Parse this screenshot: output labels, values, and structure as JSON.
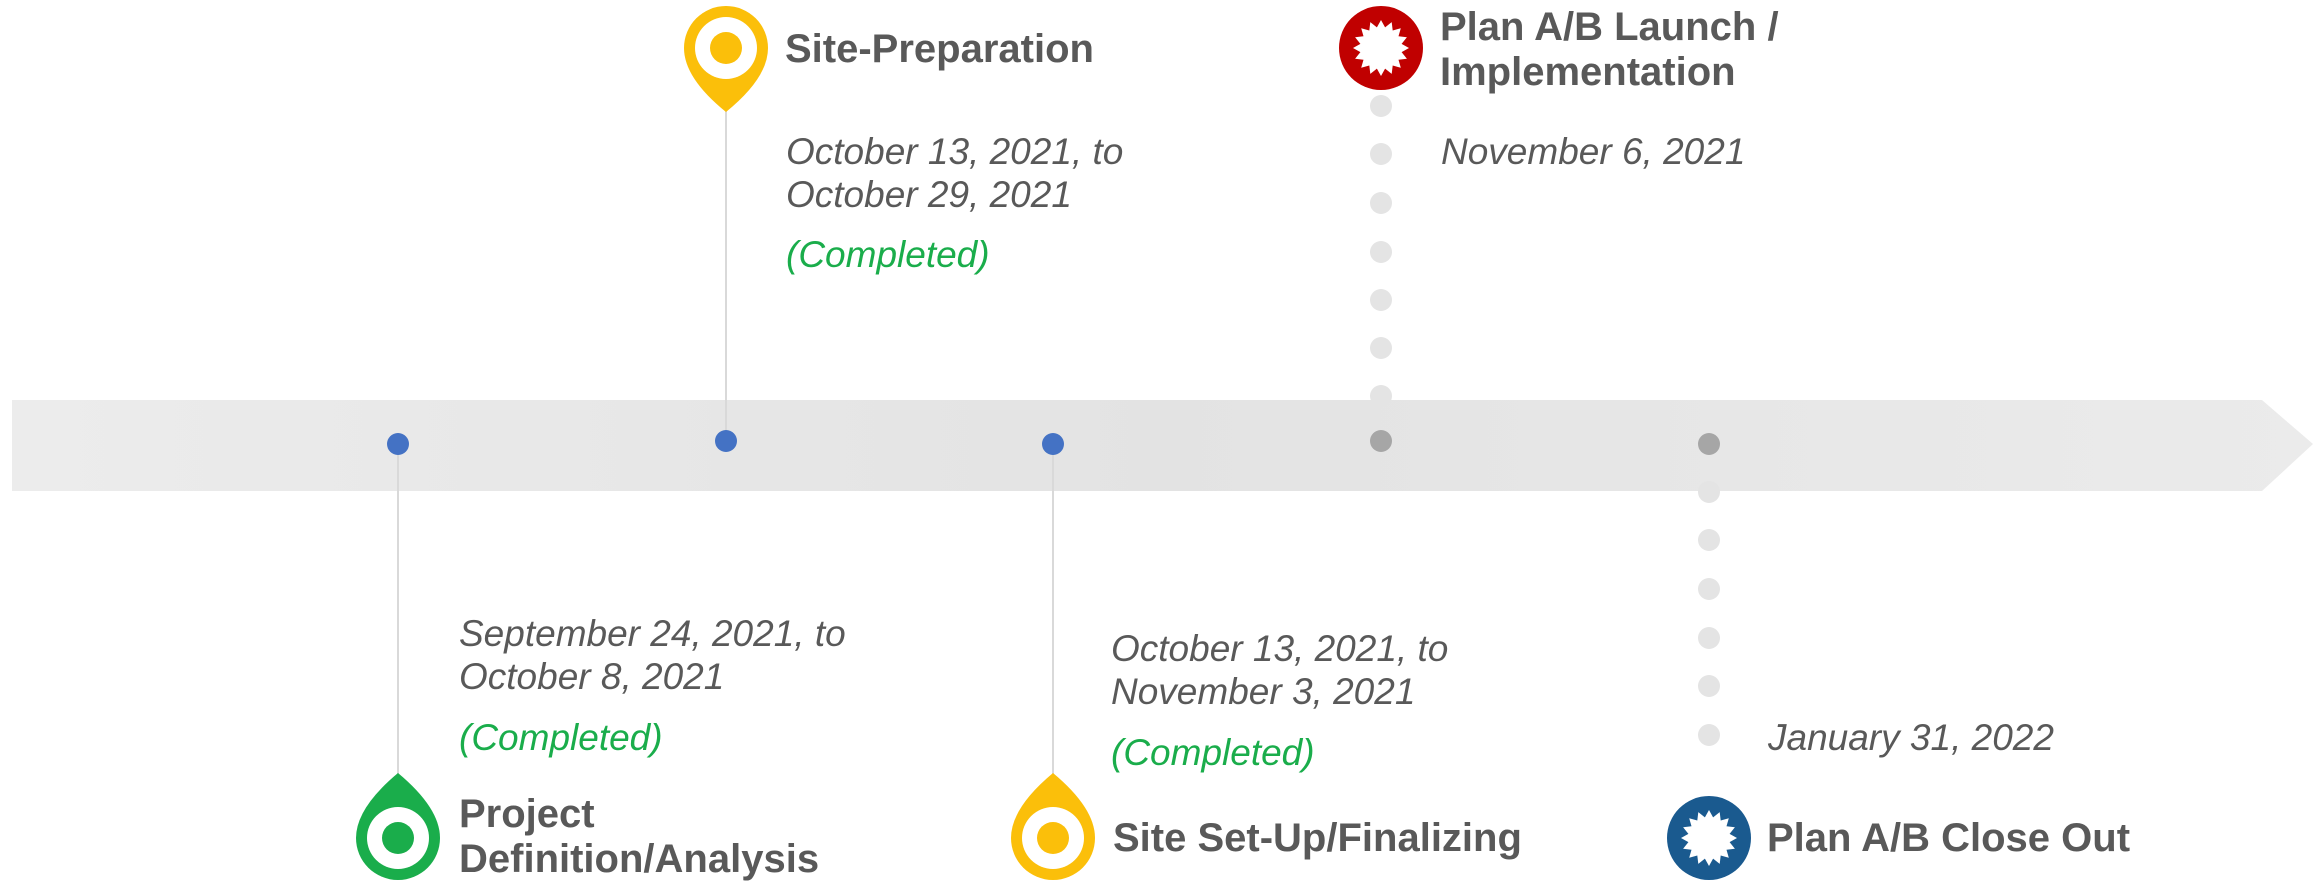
{
  "colors": {
    "arrow": "#e7e7e7",
    "text": "#595959",
    "completed": "#1aad4b",
    "blue_dot": "#4472c4",
    "gray_dot": "#a6a6a6",
    "dotted": "#e4e4e4",
    "green_pin": "#1aad4b",
    "yellow_pin": "#fbbf0a",
    "red_badge": "#c00000",
    "blue_badge": "#1a5a8f"
  },
  "milestones": [
    {
      "id": "project-definition",
      "title_line1": "Project",
      "title_line2": "Definition/Analysis",
      "dates_line1": "September 24, 2021, to",
      "dates_line2": "October 8, 2021",
      "status": "(Completed)",
      "icon": "green-pin-icon"
    },
    {
      "id": "site-preparation",
      "title_line1": "Site-Preparation",
      "dates_line1": "October 13, 2021, to",
      "dates_line2": "October 29, 2021",
      "status": "(Completed)",
      "icon": "yellow-pin-icon"
    },
    {
      "id": "site-setup",
      "title_line1": "Site Set-Up/Finalizing",
      "dates_line1": "October 13, 2021, to",
      "dates_line2": "November 3, 2021",
      "status": "(Completed)",
      "icon": "yellow-pin-icon"
    },
    {
      "id": "plan-launch",
      "title_line1": "Plan A/B Launch /",
      "title_line2": "Implementation",
      "dates_line1": "November 6, 2021",
      "icon": "red-starburst-icon"
    },
    {
      "id": "plan-closeout",
      "title_line1": "Plan A/B Close Out",
      "dates_line1": "January 31, 2022",
      "icon": "blue-starburst-icon"
    }
  ]
}
